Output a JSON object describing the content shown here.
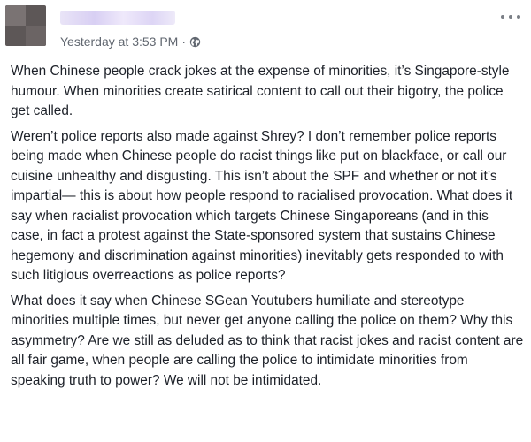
{
  "post": {
    "timestamp": "Yesterday at 3:53 PM",
    "separator": "·",
    "privacy_icon": "globe-icon",
    "menu_icon": "more-options-icon",
    "paragraphs": [
      "When Chinese people crack jokes at the expense of minorities, it’s Singapore-style humour. When minorities create satirical content to call out their bigotry, the police get called.",
      "Weren’t police reports also made against Shrey? I don’t remember police reports being made when Chinese people do racist things like put on blackface, or call our cuisine unhealthy and disgusting. This isn’t about the SPF and whether or not it’s impartial— this is about how people respond to racialised provocation. What does it say when racialist provocation which targets Chinese Singaporeans (and in this case, in fact a protest against the State-sponsored system that sustains Chinese hegemony and discrimination against minorities) inevitably gets responded to with such litigious overreactions as police reports?",
      "What does it say when Chinese SGean Youtubers humiliate and stereotype minorities multiple times, but never get anyone calling the police on them? Why this asymmetry? Are we still as deluded as to think that racist jokes and racist content are all fair game, when people are calling the police to intimidate minorities from speaking truth to power? We will not be intimidated."
    ]
  }
}
